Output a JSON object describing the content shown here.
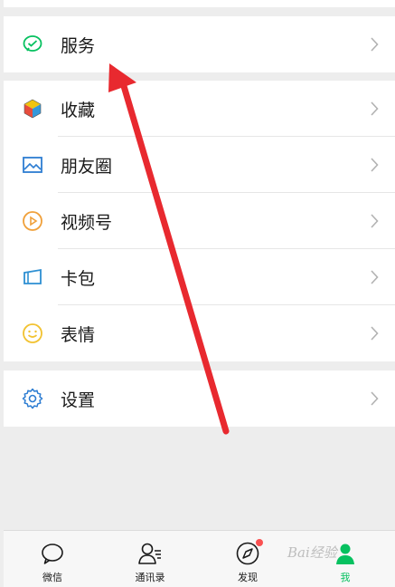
{
  "menu": {
    "services": {
      "label": "服务",
      "icon": "wechat-pay-icon"
    },
    "favorites": {
      "label": "收藏",
      "icon": "favorites-cube-icon"
    },
    "moments": {
      "label": "朋友圈",
      "icon": "moments-image-icon"
    },
    "channels": {
      "label": "视频号",
      "icon": "channels-play-icon"
    },
    "cards": {
      "label": "卡包",
      "icon": "card-wallet-icon"
    },
    "stickers": {
      "label": "表情",
      "icon": "smiley-icon"
    },
    "settings": {
      "label": "设置",
      "icon": "gear-icon"
    }
  },
  "tabbar": {
    "chats": "微信",
    "contacts": "通讯录",
    "discover": "发现",
    "me": "我"
  },
  "watermark": "Bai经验",
  "colors": {
    "accent": "#07c160",
    "badge": "#fa5151",
    "arrow": "#e8292f",
    "background": "#ededed"
  }
}
